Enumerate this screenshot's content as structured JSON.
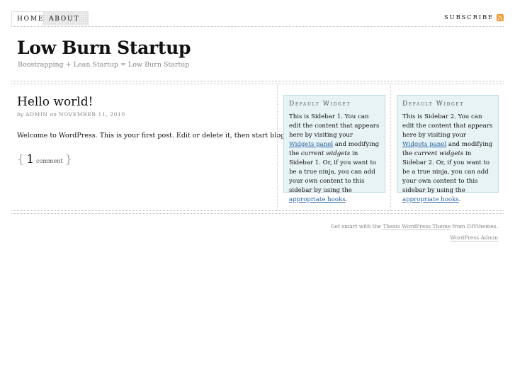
{
  "nav": {
    "tabs": [
      {
        "label": "Home",
        "active": true
      },
      {
        "label": "About",
        "active": false
      }
    ],
    "subscribe_label": "Subscribe",
    "subscribe_icon": "rss-icon"
  },
  "header": {
    "site_title": "Low Burn Startup",
    "tagline": "Boostrapping + Lean Startup = Low Burn Startup"
  },
  "post": {
    "title": "Hello world!",
    "byline_by": "by",
    "author": "admin",
    "byline_on": "on",
    "date": "November 11, 2010",
    "body": "Welcome to WordPress. This is your first post. Edit or delete it, then start blogging!",
    "comment_open": "{",
    "comment_count": "1",
    "comment_label": "comment",
    "comment_close": "}"
  },
  "sidebar1": {
    "title": "Default Widget",
    "text_a": "This is Sidebar 1. You can edit the content that appears here by visiting your ",
    "link_widgets": "Widgets panel",
    "text_b": " and modifying the ",
    "em_current": "current widgets",
    "text_c": " in Sidebar 1. Or, if you want to be a true ninja, you can add your own content to this sidebar by using the ",
    "link_hooks": "appropriate hooks",
    "text_d": "."
  },
  "sidebar2": {
    "title": "Default Widget",
    "text_a": "This is Sidebar 2. You can edit the content that appears here by visiting your ",
    "link_widgets": "Widgets panel",
    "text_b": " and modifying the ",
    "em_current": "current widgets",
    "text_c": " in Sidebar 2. Or, if you want to be a true ninja, you can add your own content to this sidebar by using the ",
    "link_hooks": "appropriate hooks",
    "text_d": "."
  },
  "footer": {
    "text_a": "Get smart with the ",
    "link_theme": "Thesis WordPress Theme",
    "text_b": " from DIYthemes.",
    "link_admin": "WordPress Admin"
  },
  "colors": {
    "widget_bg": "#e8f3f6",
    "widget_border": "#bcdbe3",
    "link": "#2361a1",
    "rss": "#f39c32"
  }
}
